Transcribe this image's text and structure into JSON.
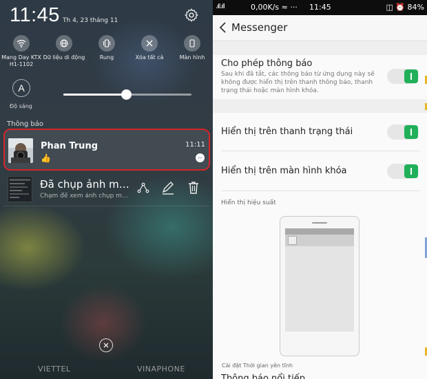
{
  "left_panel": {
    "time": "11:45",
    "date": "Th 4, 23 tháng 11",
    "quick_settings": [
      {
        "label": "Mang Day KTX\nH1-1102",
        "icon": "wifi-icon"
      },
      {
        "label": "Dữ liệu di động",
        "icon": "globe-icon"
      },
      {
        "label": "Rung",
        "icon": "vibrate-icon"
      },
      {
        "label": "Xóa tất cả",
        "icon": "close-icon"
      },
      {
        "label": "Màn hình",
        "icon": "screen-icon"
      }
    ],
    "auto_brightness_glyph": "A",
    "brightness_label": "Độ sáng",
    "brightness_level": 0.49,
    "notifications_header": "Thông báo",
    "notification": {
      "sender": "Phan Trung",
      "message": "👍",
      "time": "11:11",
      "app_icon": "messenger-icon"
    },
    "screenshot_notification": {
      "title": "Đã chụp ảnh màn hình",
      "subtitle": "Chạm để xem ảnh chụp màn hình",
      "actions": [
        "share-icon",
        "edit-icon",
        "trash-icon"
      ]
    },
    "carriers": [
      "VIETTEL",
      "VINAPHONE"
    ]
  },
  "right_panel": {
    "status_bar": {
      "signal": ".ıll.ıll",
      "speed": "0,00K/s",
      "wifi_extra": "≈ ···",
      "time": "11:45",
      "battery_extra": "◫ ⏰",
      "battery": "84%"
    },
    "app_title": "Messenger",
    "allow_notifications": {
      "title": "Cho phép thông báo",
      "description": "Sau khi đã tắt, các thông báo từ ứng dụng này sẽ không được hiển thị trên thanh thông báo, thanh trạng thái hoặc màn hình khóa.",
      "enabled": true
    },
    "show_status_bar": {
      "title": "Hiển thị trên thanh trạng thái",
      "enabled": true
    },
    "show_lock_screen": {
      "title": "Hiển thị trên màn hình khóa",
      "enabled": true
    },
    "performance_label": "Hiển thị hiệu suất",
    "quiet_time_label": "Cài đặt Thời gian yên tĩnh",
    "cutoff_label": "Thông báo nổi tiếp"
  },
  "colors": {
    "highlight_border": "#d4262b",
    "toggle_on": "#21b05a"
  }
}
